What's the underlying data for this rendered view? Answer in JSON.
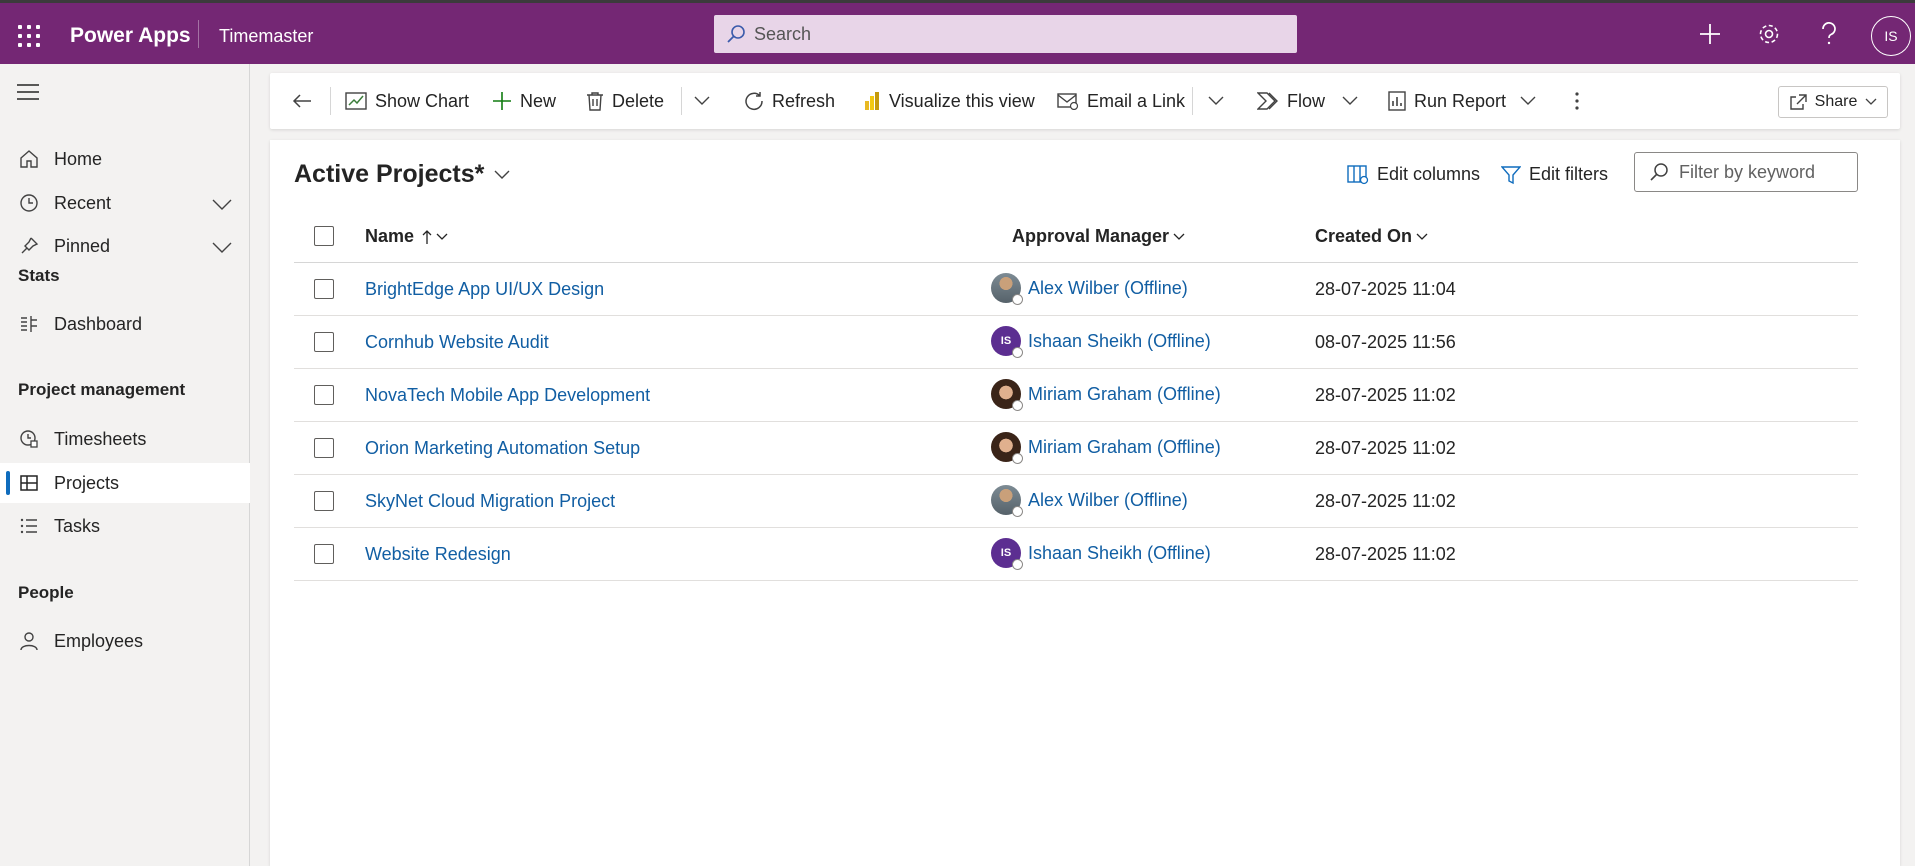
{
  "topbar": {
    "app_name": "Power Apps",
    "env_name": "Timemaster",
    "search_placeholder": "Search",
    "user_initials": "IS",
    "brand_color": "#742774"
  },
  "sidebar": {
    "items_top": [
      {
        "label": "Home",
        "icon": "home-icon"
      },
      {
        "label": "Recent",
        "icon": "clock-icon",
        "expandable": true
      },
      {
        "label": "Pinned",
        "icon": "pin-icon",
        "expandable": true
      }
    ],
    "groups": [
      {
        "title": "Stats",
        "items": [
          {
            "label": "Dashboard",
            "icon": "dashboard-icon"
          }
        ]
      },
      {
        "title": "Project management",
        "items": [
          {
            "label": "Timesheets",
            "icon": "timesheet-icon"
          },
          {
            "label": "Projects",
            "icon": "projects-icon",
            "active": true
          },
          {
            "label": "Tasks",
            "icon": "list-icon"
          }
        ]
      },
      {
        "title": "People",
        "items": [
          {
            "label": "Employees",
            "icon": "person-icon"
          }
        ]
      }
    ]
  },
  "commands": {
    "show_chart": "Show Chart",
    "new": "New",
    "delete": "Delete",
    "refresh": "Refresh",
    "visualize": "Visualize this view",
    "email_link": "Email a Link",
    "flow": "Flow",
    "run_report": "Run Report",
    "share": "Share"
  },
  "view": {
    "title": "Active Projects*",
    "edit_columns": "Edit columns",
    "edit_filters": "Edit filters",
    "filter_placeholder": "Filter by keyword"
  },
  "grid": {
    "columns": {
      "name": "Name",
      "manager": "Approval Manager",
      "created": "Created On"
    },
    "rows": [
      {
        "name": "BrightEdge App UI/UX Design",
        "manager": "Alex Wilber (Offline)",
        "avatar": "alex",
        "created": "28-07-2025 11:04"
      },
      {
        "name": "Cornhub Website Audit",
        "manager": "Ishaan Sheikh (Offline)",
        "avatar": "is",
        "created": "08-07-2025 11:56"
      },
      {
        "name": "NovaTech Mobile App Development",
        "manager": "Miriam Graham (Offline)",
        "avatar": "miriam",
        "created": "28-07-2025 11:02"
      },
      {
        "name": "Orion Marketing Automation Setup",
        "manager": "Miriam Graham (Offline)",
        "avatar": "miriam",
        "created": "28-07-2025 11:02"
      },
      {
        "name": "SkyNet Cloud Migration Project",
        "manager": "Alex Wilber (Offline)",
        "avatar": "alex",
        "created": "28-07-2025 11:02"
      },
      {
        "name": "Website Redesign",
        "manager": "Ishaan Sheikh (Offline)",
        "avatar": "is",
        "created": "28-07-2025 11:02"
      }
    ]
  }
}
